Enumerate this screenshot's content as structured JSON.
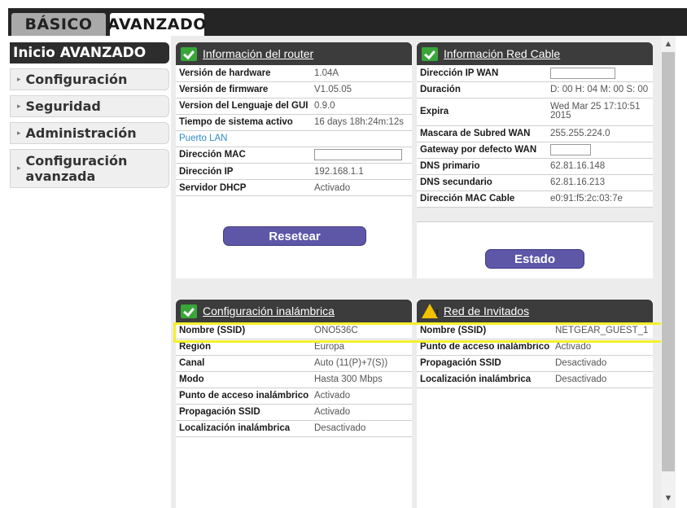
{
  "tabs": {
    "basic": "BÁSICO",
    "advanced": "AVANZADO"
  },
  "sidebar": {
    "header": "Inicio AVANZADO",
    "items": [
      {
        "label": "Configuración"
      },
      {
        "label": "Seguridad"
      },
      {
        "label": "Administración"
      },
      {
        "label_line1": "Configuración",
        "label_line2": "avanzada"
      }
    ]
  },
  "router_info": {
    "title": "Información del router",
    "rows": [
      {
        "k": "Versión de hardware",
        "v": "1.04A"
      },
      {
        "k": "Versión de firmware",
        "v": "V1.05.05"
      },
      {
        "k": "Version del Lenguaje del GUI",
        "v": "0.9.0"
      },
      {
        "k": "Tiempo de sistema activo",
        "v": "16 days 18h:24m:12s"
      }
    ],
    "lan_title": "Puerto LAN",
    "lan_rows": [
      {
        "k": "Dirección MAC",
        "v": ""
      },
      {
        "k": "Dirección IP",
        "v": "192.168.1.1"
      },
      {
        "k": "Servidor DHCP",
        "v": "Activado"
      }
    ],
    "button": "Resetear"
  },
  "cable_info": {
    "title": "Información Red Cable",
    "rows": [
      {
        "k": "Dirección IP WAN",
        "v": ""
      },
      {
        "k": "Duración",
        "v": "D: 00 H: 04 M: 00 S: 00"
      },
      {
        "k": "Expira",
        "v1": "Wed Mar 25 17:10:51",
        "v2": "2015"
      },
      {
        "k": "Mascara de Subred WAN",
        "v": "255.255.224.0"
      },
      {
        "k": "Gateway por defecto WAN",
        "v": ""
      },
      {
        "k": "DNS primario",
        "v": "62.81.16.148"
      },
      {
        "k": "DNS secundario",
        "v": "62.81.16.213"
      },
      {
        "k": "Dirección MAC Cable",
        "v": "e0:91:f5:2c:03:7e"
      }
    ],
    "button": "Estado"
  },
  "wireless": {
    "title": "Configuración inalámbrica",
    "rows": [
      {
        "k": "Nombre (SSID)",
        "v": "ONO536C"
      },
      {
        "k": "Región",
        "v": "Europa"
      },
      {
        "k": "Canal",
        "v": "Auto (11(P)+7(S))"
      },
      {
        "k": "Modo",
        "v": "Hasta 300 Mbps"
      },
      {
        "k": "Punto de acceso inalámbrico",
        "v": "Activado"
      },
      {
        "k": "Propagación SSID",
        "v": "Activado"
      },
      {
        "k": "Localización inalámbrica",
        "v": "Desactivado"
      }
    ]
  },
  "guest": {
    "title": "Red de Invitados",
    "rows": [
      {
        "k": "Nombre (SSID)",
        "v": "NETGEAR_GUEST_1"
      },
      {
        "k": "Punto de acceso inalámbrico",
        "v": "Activado"
      },
      {
        "k": "Propagación SSID",
        "v": "Desactivado"
      },
      {
        "k": "Localización inalámbrica",
        "v": "Desactivado"
      }
    ]
  },
  "colors": {
    "accent_button": "#5e57a8",
    "check_green": "#3aa63a",
    "warning_yellow": "#f2c200",
    "highlight": "#f4ef2c",
    "lan_link": "#2e8bc9"
  },
  "icons": {
    "check": "check-icon",
    "warning": "warning-icon",
    "scroll_up": "▲",
    "scroll_down": "▼",
    "arrow": "▸"
  }
}
